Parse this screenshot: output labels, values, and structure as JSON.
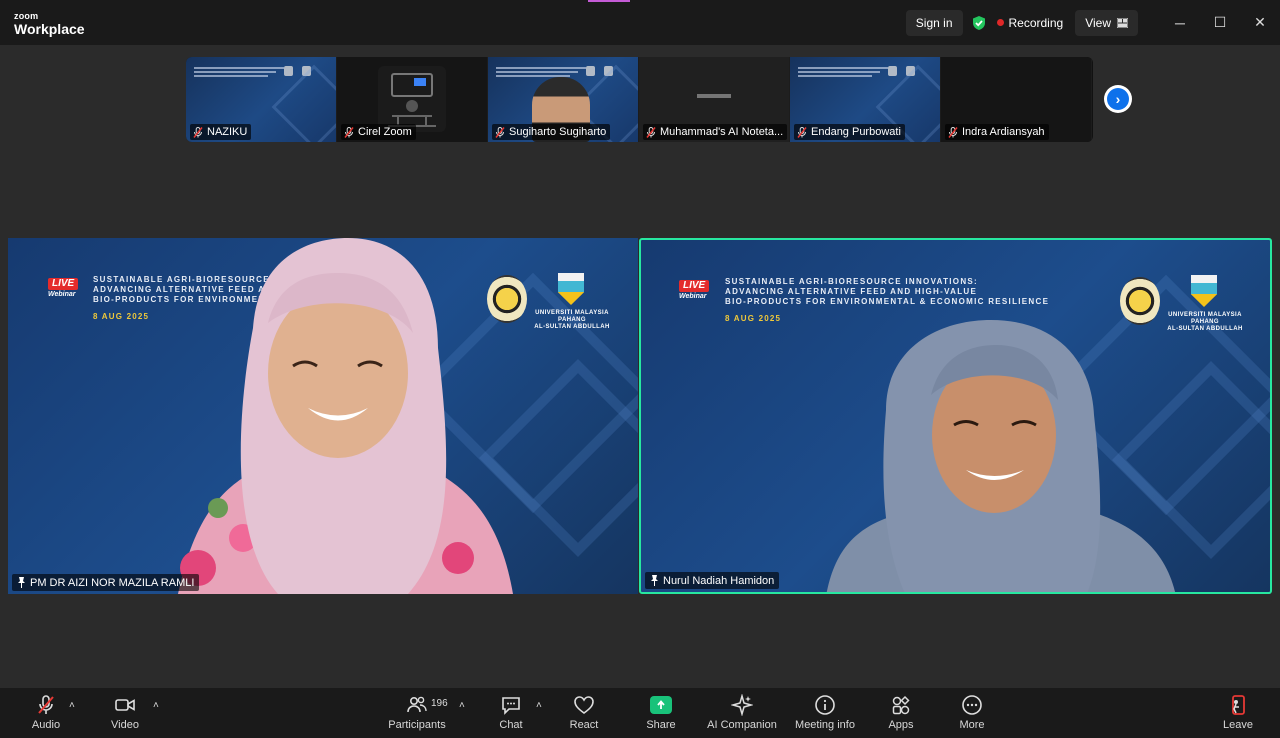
{
  "titlebar": {
    "brand_small": "zoom",
    "brand_large": "Workplace",
    "sign_in": "Sign in",
    "recording": "Recording",
    "view": "View",
    "minimize": "─",
    "maximize": "☐",
    "close": "✕"
  },
  "strip": {
    "participants": [
      {
        "name": "NAZIKU",
        "style": "blue"
      },
      {
        "name": "Cirel Zoom",
        "style": "dark"
      },
      {
        "name": "Sugiharto Sugiharto",
        "style": "blue"
      },
      {
        "name": "Muhammad's AI Noteta...",
        "style": "gray"
      },
      {
        "name": "Endang Purbowati",
        "style": "blue"
      },
      {
        "name": "Indra Ardiansyah",
        "style": "dark"
      }
    ],
    "next_icon": "›"
  },
  "banner": {
    "live": "LIVE",
    "webinar": "Webinar",
    "title_line1": "SUSTAINABLE AGRI-BIORESOURCE INNOVATIONS:",
    "title_line2": "ADVANCING ALTERNATIVE FEED AND HIGH-VALUE",
    "title_line3": "BIO-PRODUCTS FOR ENVIRONMENTAL & ECONOMIC RESILIENCE",
    "left_title_line1": "SUSTAINABLE AGRI-BIORESOURCE",
    "left_title_line2": "ADVANCING ALTERNATIVE FEED A",
    "left_title_line3": "BIO-PRODUCTS FOR ENVIRONMENT",
    "date": "8 AUG 2025",
    "university_line1": "UNIVERSITI MALAYSIA PAHANG",
    "university_line2": "AL-SULTAN ABDULLAH"
  },
  "speakers": {
    "left": {
      "name": "PM DR AIZI NOR MAZILA RAMLI"
    },
    "right": {
      "name": "Nurul Nadiah Hamidon"
    }
  },
  "toolbar": {
    "audio": "Audio",
    "video": "Video",
    "participants": "Participants",
    "participants_count": "196",
    "chat": "Chat",
    "react": "React",
    "share": "Share",
    "ai_companion": "AI Companion",
    "meeting_info": "Meeting info",
    "apps": "Apps",
    "more": "More",
    "leave": "Leave",
    "caret": "˄"
  },
  "colors": {
    "active_speaker_border": "#27e7a0",
    "share_green": "#19c27a",
    "recording_red": "#e02828",
    "next_button_blue": "#0e71eb"
  }
}
